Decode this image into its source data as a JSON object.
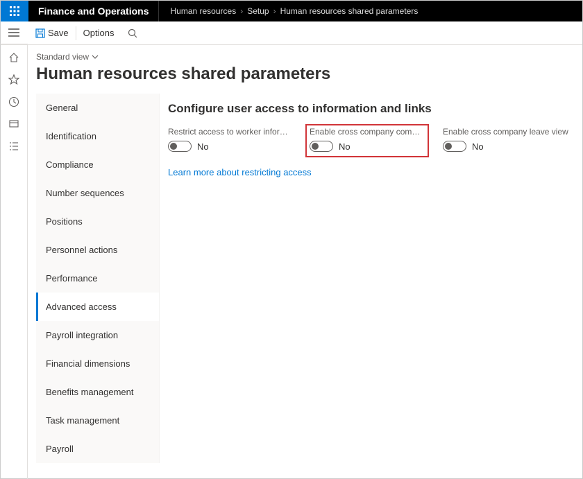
{
  "header": {
    "brand": "Finance and Operations",
    "breadcrumb": [
      "Human resources",
      "Setup",
      "Human resources shared parameters"
    ]
  },
  "actions": {
    "save": "Save",
    "options": "Options"
  },
  "view": {
    "label": "Standard view"
  },
  "page": {
    "title": "Human resources shared parameters"
  },
  "sidenav": {
    "items": [
      "General",
      "Identification",
      "Compliance",
      "Number sequences",
      "Positions",
      "Personnel actions",
      "Performance",
      "Advanced access",
      "Payroll integration",
      "Financial dimensions",
      "Benefits management",
      "Task management",
      "Payroll"
    ],
    "selected_index": 7
  },
  "pane": {
    "heading": "Configure user access to information and links",
    "fields": [
      {
        "label": "Restrict access to worker informa...",
        "value": "No"
      },
      {
        "label": "Enable cross company compensa...",
        "value": "No"
      },
      {
        "label": "Enable cross company leave view",
        "value": "No"
      }
    ],
    "link": "Learn more about restricting access"
  }
}
